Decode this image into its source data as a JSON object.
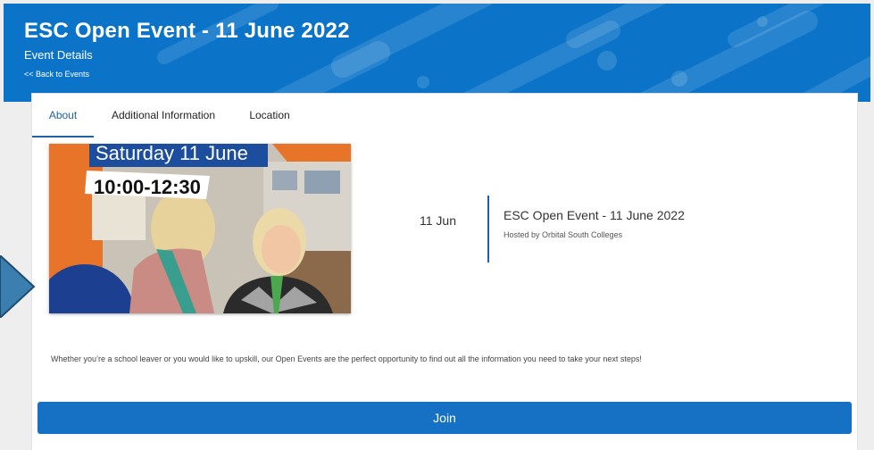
{
  "header": {
    "title": "ESC Open Event - 11 June 2022",
    "subtitle": "Event Details",
    "back_link": "<< Back to Events"
  },
  "tabs": [
    {
      "label": "About",
      "active": true
    },
    {
      "label": "Additional Information",
      "active": false
    },
    {
      "label": "Location",
      "active": false
    }
  ],
  "event": {
    "image_text_day": "Saturday 11 June",
    "image_text_time": "10:00-12:30",
    "date": "11 Jun",
    "name": "ESC Open Event - 11 June 2022",
    "host": "Hosted by Orbital South Colleges",
    "description": "Whether you’re a school leaver or you would like to upskill, our Open Events are the perfect opportunity to find out all the information you need to take your next steps!"
  },
  "actions": {
    "join_label": "Join"
  },
  "colors": {
    "banner": "#0b74c8",
    "accent": "#1f62a8",
    "button": "#1670c4",
    "side_arrow": "#3a7fb0"
  }
}
